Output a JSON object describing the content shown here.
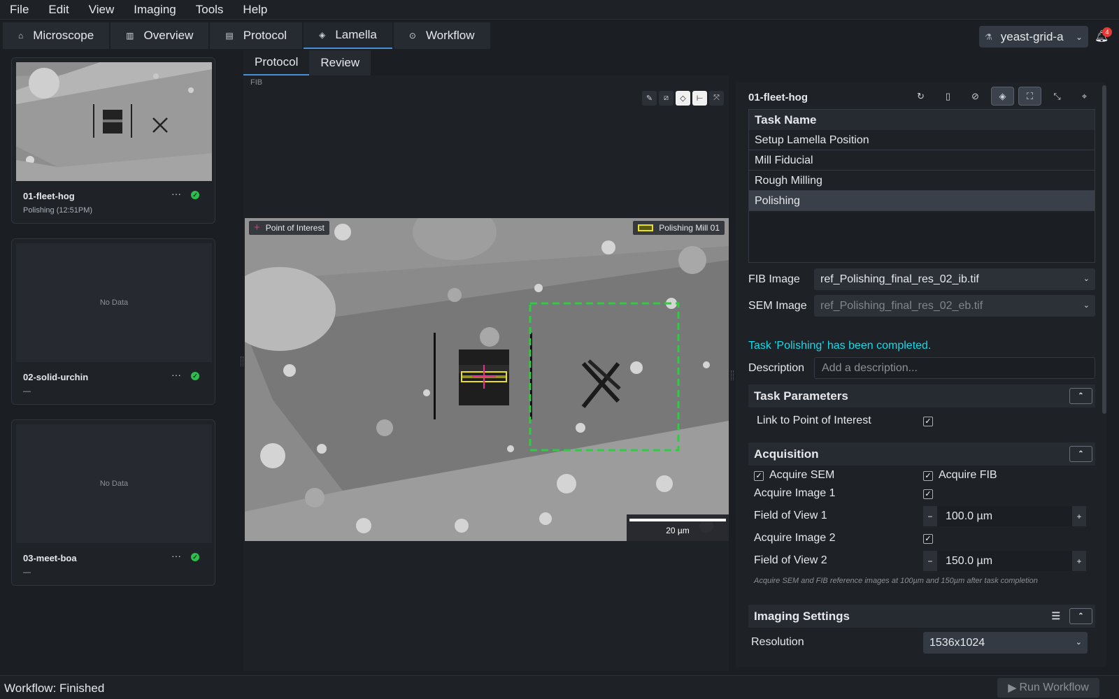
{
  "menu": [
    "File",
    "Edit",
    "View",
    "Imaging",
    "Tools",
    "Help"
  ],
  "main_tabs": [
    {
      "label": "Microscope",
      "icon": "microscope-icon"
    },
    {
      "label": "Overview",
      "icon": "map-icon"
    },
    {
      "label": "Protocol",
      "icon": "document-icon"
    },
    {
      "label": "Lamella",
      "icon": "layers-icon",
      "active": true
    },
    {
      "label": "Workflow",
      "icon": "play-circle-icon"
    }
  ],
  "project": {
    "name": "yeast-grid-a",
    "notifications": "4"
  },
  "lamellae": [
    {
      "name": "01-fleet-hog",
      "status": "Polishing (12:51PM)",
      "has_image": true
    },
    {
      "name": "02-solid-urchin",
      "status": "—",
      "has_image": false,
      "placeholder": "No Data"
    },
    {
      "name": "03-meet-boa",
      "status": "—",
      "has_image": false,
      "placeholder": "No Data"
    }
  ],
  "sub_tabs": [
    "Protocol",
    "Review"
  ],
  "viewer": {
    "beam_label": "FIB",
    "legend_left": "Point of Interest",
    "legend_right": "Polishing Mill 01",
    "scale": "20 µm",
    "colors": {
      "poi": "#e6308a",
      "mill": "#e8e020",
      "fiducial_box": "#2ecc40"
    }
  },
  "panel": {
    "lamella_name": "01-fleet-hog",
    "task_header": "Task Name",
    "tasks": [
      "Setup Lamella Position",
      "Mill Fiducial",
      "Rough Milling",
      "Polishing"
    ],
    "selected_task": 3,
    "fib_image_label": "FIB Image",
    "fib_image_value": "ref_Polishing_final_res_02_ib.tif",
    "sem_image_label": "SEM Image",
    "sem_image_value": "ref_Polishing_final_res_02_eb.tif",
    "completed_msg": "Task 'Polishing' has been completed.",
    "description_label": "Description",
    "description_placeholder": "Add a description...",
    "task_params_title": "Task Parameters",
    "link_poi_label": "Link to Point of Interest",
    "acquisition_title": "Acquisition",
    "acquire_sem": "Acquire SEM",
    "acquire_fib": "Acquire FIB",
    "acquire_img1": "Acquire Image 1",
    "fov1_label": "Field of View 1",
    "fov1_value": "100.0  µm",
    "acquire_img2": "Acquire Image 2",
    "fov2_label": "Field of View 2",
    "fov2_value": "150.0  µm",
    "hint": "Acquire SEM and FIB reference images at 100µm and 150µm after task completion",
    "imaging_title": "Imaging Settings",
    "resolution_label": "Resolution",
    "resolution_value": "1536x1024"
  },
  "status": {
    "text": "Workflow: Finished",
    "run_button": "Run Workflow"
  }
}
